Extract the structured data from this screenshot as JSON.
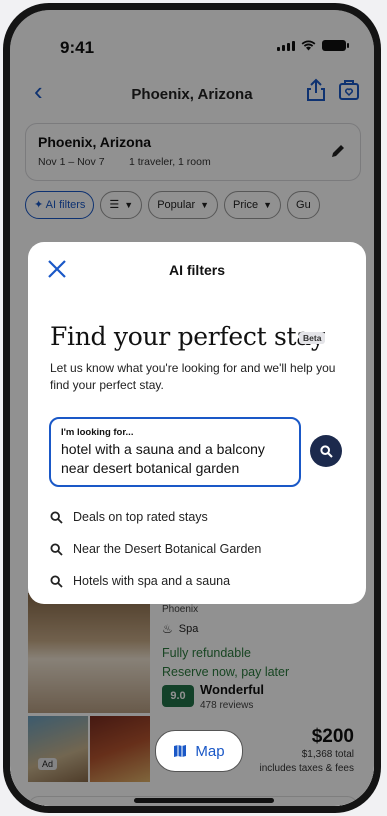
{
  "status_bar": {
    "time": "9:41"
  },
  "header": {
    "title": "Phoenix, Arizona"
  },
  "search": {
    "city": "Phoenix, Arizona",
    "dates": "Nov 1 – Nov 7",
    "guests": "1 traveler, 1 room"
  },
  "chips": [
    {
      "label": "AI filters"
    },
    {
      "label": ""
    },
    {
      "label": "Popular"
    },
    {
      "label": "Price"
    },
    {
      "label": "Gu"
    }
  ],
  "listing": {
    "city": "Phoenix",
    "amenity": "Spa",
    "refund": "Fully refundable",
    "reserve": "Reserve now, pay later",
    "score": "9.0",
    "rating_word": "Wonderful",
    "reviews": "478 reviews",
    "price": "$200",
    "total": "$1,368 total",
    "fees": "includes taxes & fees",
    "ad_badge": "Ad",
    "map_label": "Map"
  },
  "modal": {
    "title": "AI filters",
    "headline": "Find your perfect stay",
    "beta": "Beta",
    "subtext": "Let us know what you're looking for and we'll help you find your perfect stay.",
    "query_label": "I'm looking for...",
    "query_text": "hotel with a sauna and a balcony near desert botanical garden",
    "suggestions": [
      "Deals on top rated stays",
      "Near the Desert Botanical Garden",
      "Hotels with spa and a sauna"
    ]
  },
  "colors": {
    "accent": "#1a58c7",
    "score_bg": "#227349",
    "refund": "#2a7a3c",
    "submit": "#1c2a4d"
  }
}
